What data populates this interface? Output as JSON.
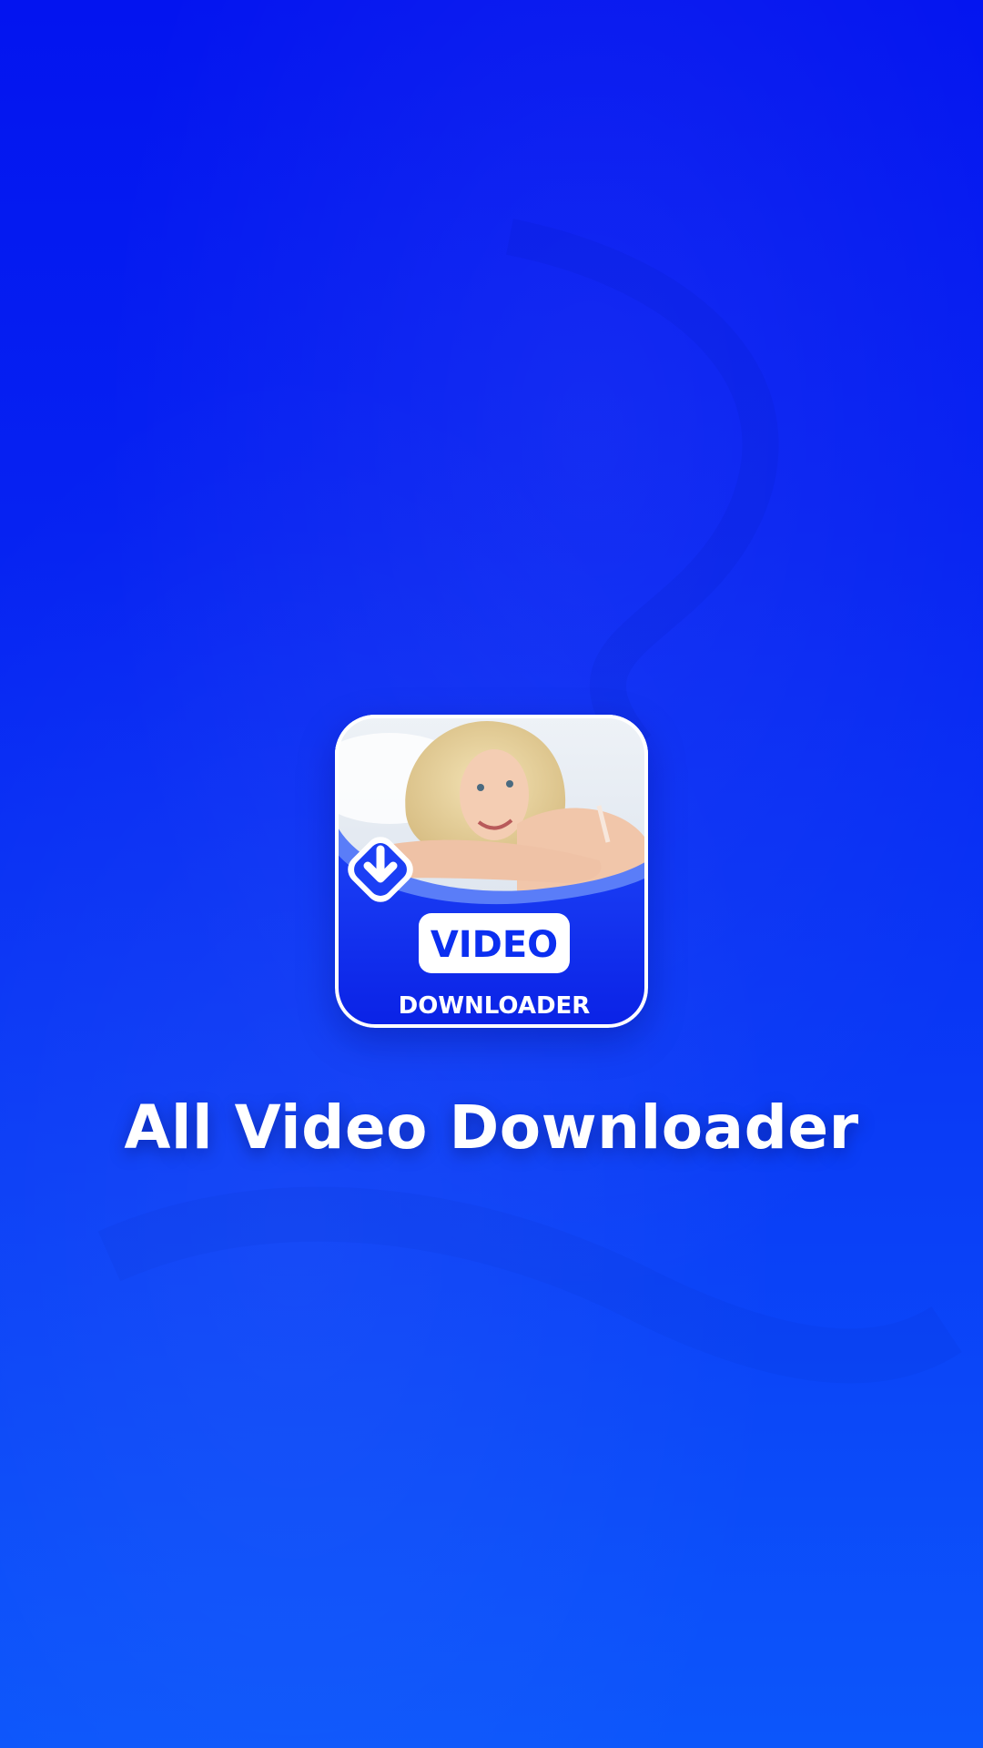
{
  "app_icon": {
    "badge_text": "VIDEO",
    "subtitle_text": "DOWNLOADER",
    "icon": "download-arrow-icon",
    "photo": "woman-portrait-photo"
  },
  "app_title": "All Video Downloader",
  "colors": {
    "background_top": "#0314f0",
    "background_bottom": "#0c56fb",
    "icon_blue": "#0b2ff0",
    "icon_light_blue": "#5a7df8",
    "white": "#ffffff"
  }
}
